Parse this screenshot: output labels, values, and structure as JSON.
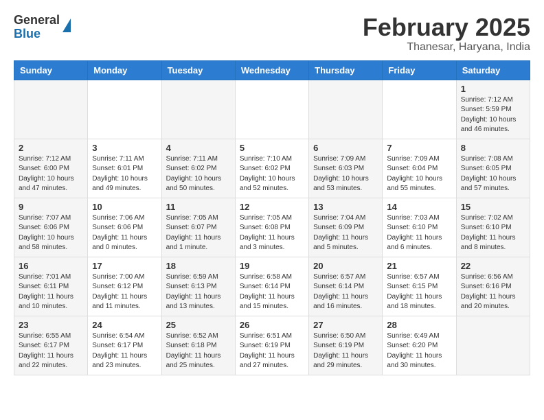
{
  "header": {
    "logo": {
      "general": "General",
      "blue": "Blue"
    },
    "title": "February 2025",
    "location": "Thanesar, Haryana, India"
  },
  "days": [
    "Sunday",
    "Monday",
    "Tuesday",
    "Wednesday",
    "Thursday",
    "Friday",
    "Saturday"
  ],
  "weeks": [
    [
      {
        "day": "",
        "info": ""
      },
      {
        "day": "",
        "info": ""
      },
      {
        "day": "",
        "info": ""
      },
      {
        "day": "",
        "info": ""
      },
      {
        "day": "",
        "info": ""
      },
      {
        "day": "",
        "info": ""
      },
      {
        "day": "1",
        "info": "Sunrise: 7:12 AM\nSunset: 5:59 PM\nDaylight: 10 hours\nand 46 minutes."
      }
    ],
    [
      {
        "day": "2",
        "info": "Sunrise: 7:12 AM\nSunset: 6:00 PM\nDaylight: 10 hours\nand 47 minutes."
      },
      {
        "day": "3",
        "info": "Sunrise: 7:11 AM\nSunset: 6:01 PM\nDaylight: 10 hours\nand 49 minutes."
      },
      {
        "day": "4",
        "info": "Sunrise: 7:11 AM\nSunset: 6:02 PM\nDaylight: 10 hours\nand 50 minutes."
      },
      {
        "day": "5",
        "info": "Sunrise: 7:10 AM\nSunset: 6:02 PM\nDaylight: 10 hours\nand 52 minutes."
      },
      {
        "day": "6",
        "info": "Sunrise: 7:09 AM\nSunset: 6:03 PM\nDaylight: 10 hours\nand 53 minutes."
      },
      {
        "day": "7",
        "info": "Sunrise: 7:09 AM\nSunset: 6:04 PM\nDaylight: 10 hours\nand 55 minutes."
      },
      {
        "day": "8",
        "info": "Sunrise: 7:08 AM\nSunset: 6:05 PM\nDaylight: 10 hours\nand 57 minutes."
      }
    ],
    [
      {
        "day": "9",
        "info": "Sunrise: 7:07 AM\nSunset: 6:06 PM\nDaylight: 10 hours\nand 58 minutes."
      },
      {
        "day": "10",
        "info": "Sunrise: 7:06 AM\nSunset: 6:06 PM\nDaylight: 11 hours\nand 0 minutes."
      },
      {
        "day": "11",
        "info": "Sunrise: 7:05 AM\nSunset: 6:07 PM\nDaylight: 11 hours\nand 1 minute."
      },
      {
        "day": "12",
        "info": "Sunrise: 7:05 AM\nSunset: 6:08 PM\nDaylight: 11 hours\nand 3 minutes."
      },
      {
        "day": "13",
        "info": "Sunrise: 7:04 AM\nSunset: 6:09 PM\nDaylight: 11 hours\nand 5 minutes."
      },
      {
        "day": "14",
        "info": "Sunrise: 7:03 AM\nSunset: 6:10 PM\nDaylight: 11 hours\nand 6 minutes."
      },
      {
        "day": "15",
        "info": "Sunrise: 7:02 AM\nSunset: 6:10 PM\nDaylight: 11 hours\nand 8 minutes."
      }
    ],
    [
      {
        "day": "16",
        "info": "Sunrise: 7:01 AM\nSunset: 6:11 PM\nDaylight: 11 hours\nand 10 minutes."
      },
      {
        "day": "17",
        "info": "Sunrise: 7:00 AM\nSunset: 6:12 PM\nDaylight: 11 hours\nand 11 minutes."
      },
      {
        "day": "18",
        "info": "Sunrise: 6:59 AM\nSunset: 6:13 PM\nDaylight: 11 hours\nand 13 minutes."
      },
      {
        "day": "19",
        "info": "Sunrise: 6:58 AM\nSunset: 6:14 PM\nDaylight: 11 hours\nand 15 minutes."
      },
      {
        "day": "20",
        "info": "Sunrise: 6:57 AM\nSunset: 6:14 PM\nDaylight: 11 hours\nand 16 minutes."
      },
      {
        "day": "21",
        "info": "Sunrise: 6:57 AM\nSunset: 6:15 PM\nDaylight: 11 hours\nand 18 minutes."
      },
      {
        "day": "22",
        "info": "Sunrise: 6:56 AM\nSunset: 6:16 PM\nDaylight: 11 hours\nand 20 minutes."
      }
    ],
    [
      {
        "day": "23",
        "info": "Sunrise: 6:55 AM\nSunset: 6:17 PM\nDaylight: 11 hours\nand 22 minutes."
      },
      {
        "day": "24",
        "info": "Sunrise: 6:54 AM\nSunset: 6:17 PM\nDaylight: 11 hours\nand 23 minutes."
      },
      {
        "day": "25",
        "info": "Sunrise: 6:52 AM\nSunset: 6:18 PM\nDaylight: 11 hours\nand 25 minutes."
      },
      {
        "day": "26",
        "info": "Sunrise: 6:51 AM\nSunset: 6:19 PM\nDaylight: 11 hours\nand 27 minutes."
      },
      {
        "day": "27",
        "info": "Sunrise: 6:50 AM\nSunset: 6:19 PM\nDaylight: 11 hours\nand 29 minutes."
      },
      {
        "day": "28",
        "info": "Sunrise: 6:49 AM\nSunset: 6:20 PM\nDaylight: 11 hours\nand 30 minutes."
      },
      {
        "day": "",
        "info": ""
      }
    ]
  ]
}
